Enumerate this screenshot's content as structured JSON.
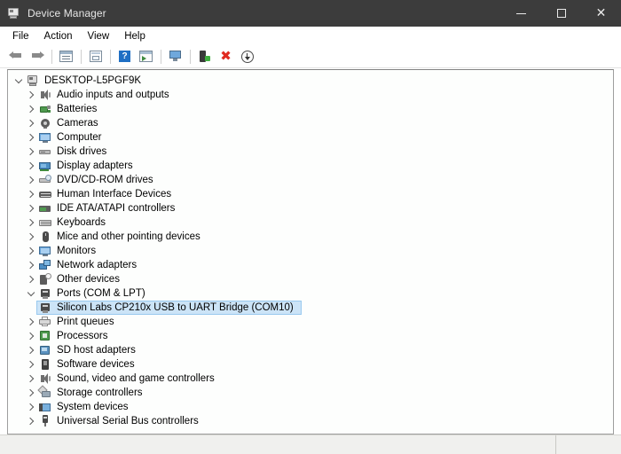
{
  "window": {
    "title": "Device Manager",
    "icon": "device-manager-icon",
    "controls": {
      "minimize": "—",
      "maximize": "□",
      "close": "✕"
    }
  },
  "menubar": {
    "items": [
      {
        "label": "File"
      },
      {
        "label": "Action"
      },
      {
        "label": "View"
      },
      {
        "label": "Help"
      }
    ]
  },
  "toolbar": {
    "buttons": [
      {
        "name": "back-button",
        "icon": "arrow-left-icon",
        "title": "Back"
      },
      {
        "name": "forward-button",
        "icon": "arrow-right-icon",
        "title": "Forward"
      },
      {
        "name": "properties-button",
        "icon": "properties-icon",
        "title": "Properties"
      },
      {
        "name": "update-driver-button",
        "icon": "update-driver-icon",
        "title": "Update driver"
      },
      {
        "name": "help-button",
        "icon": "help-icon",
        "title": "Help",
        "glyph": "?"
      },
      {
        "name": "scan-hardware-changes-button",
        "icon": "scan-icon",
        "title": "Scan for hardware changes"
      },
      {
        "name": "show-hidden-devices-button",
        "icon": "monitor-icon",
        "title": "Show hidden devices"
      },
      {
        "name": "enable-device-button",
        "icon": "device-plug-icon",
        "title": "Enable device"
      },
      {
        "name": "uninstall-device-button",
        "icon": "red-x-icon",
        "title": "Uninstall device",
        "glyph": "✖"
      },
      {
        "name": "disable-device-button",
        "icon": "disable-circle-arrow-icon",
        "title": "Disable device"
      }
    ]
  },
  "tree": {
    "root": {
      "label": "DESKTOP-L5PGF9K",
      "icon": "computer-icon",
      "expanded": true
    },
    "nodes": [
      {
        "label": "Audio inputs and outputs",
        "icon": "speaker-icon",
        "expanded": false,
        "depth": 1
      },
      {
        "label": "Batteries",
        "icon": "battery-icon",
        "expanded": false,
        "depth": 1
      },
      {
        "label": "Cameras",
        "icon": "camera-icon",
        "expanded": false,
        "depth": 1
      },
      {
        "label": "Computer",
        "icon": "monitor-icon",
        "expanded": false,
        "depth": 1
      },
      {
        "label": "Disk drives",
        "icon": "disk-drive-icon",
        "expanded": false,
        "depth": 1
      },
      {
        "label": "Display adapters",
        "icon": "display-adapter-icon",
        "expanded": false,
        "depth": 1
      },
      {
        "label": "DVD/CD-ROM drives",
        "icon": "dvd-drive-icon",
        "expanded": false,
        "depth": 1
      },
      {
        "label": "Human Interface Devices",
        "icon": "hid-icon",
        "expanded": false,
        "depth": 1
      },
      {
        "label": "IDE ATA/ATAPI controllers",
        "icon": "ide-controller-icon",
        "expanded": false,
        "depth": 1
      },
      {
        "label": "Keyboards",
        "icon": "keyboard-icon",
        "expanded": false,
        "depth": 1
      },
      {
        "label": "Mice and other pointing devices",
        "icon": "mouse-icon",
        "expanded": false,
        "depth": 1
      },
      {
        "label": "Monitors",
        "icon": "monitor-icon",
        "expanded": false,
        "depth": 1
      },
      {
        "label": "Network adapters",
        "icon": "network-adapter-icon",
        "expanded": false,
        "depth": 1
      },
      {
        "label": "Other devices",
        "icon": "other-device-icon",
        "expanded": false,
        "depth": 1
      },
      {
        "label": "Ports (COM & LPT)",
        "icon": "port-icon",
        "expanded": true,
        "depth": 1
      },
      {
        "label": "Silicon Labs CP210x USB to UART Bridge (COM10)",
        "icon": "port-icon",
        "depth": 2,
        "selected": true,
        "leaf": true
      },
      {
        "label": "Print queues",
        "icon": "printer-icon",
        "expanded": false,
        "depth": 1
      },
      {
        "label": "Processors",
        "icon": "processor-icon",
        "expanded": false,
        "depth": 1
      },
      {
        "label": "SD host adapters",
        "icon": "sd-host-adapter-icon",
        "expanded": false,
        "depth": 1
      },
      {
        "label": "Software devices",
        "icon": "software-device-icon",
        "expanded": false,
        "depth": 1
      },
      {
        "label": "Sound, video and game controllers",
        "icon": "sound-controller-icon",
        "expanded": false,
        "depth": 1
      },
      {
        "label": "Storage controllers",
        "icon": "storage-controller-icon",
        "expanded": false,
        "depth": 1
      },
      {
        "label": "System devices",
        "icon": "system-device-icon",
        "expanded": false,
        "depth": 1
      },
      {
        "label": "Universal Serial Bus controllers",
        "icon": "usb-controller-icon",
        "expanded": false,
        "depth": 1
      }
    ]
  },
  "statusbar": {
    "message": "",
    "right_panel": ""
  },
  "colors": {
    "titlebar_bg": "#3c3c3c",
    "titlebar_text": "#e6e6e6",
    "selection_bg": "#cce4f7",
    "selection_border": "#99c9ef",
    "panel_border": "#9e9e9e",
    "statusbar_bg": "#f0f0ee"
  }
}
